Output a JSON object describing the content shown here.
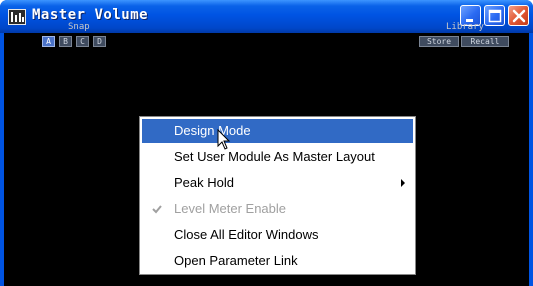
{
  "window": {
    "title": "Master Volume",
    "app_icon": "app-icon",
    "controls": [
      "minimize-icon",
      "maximize-icon",
      "close-icon"
    ]
  },
  "snap": {
    "label": "Snap",
    "buttons": [
      "A",
      "B",
      "C",
      "D"
    ],
    "active": "A"
  },
  "library": {
    "label": "Library",
    "store_label": "Store",
    "recall_label": "Recall"
  },
  "context_menu": {
    "items": [
      {
        "label": "Design Mode",
        "highlighted": true
      },
      {
        "label": "Set User Module As Master Layout"
      },
      {
        "label": "Peak Hold",
        "submenu": true
      },
      {
        "label": "Level Meter Enable",
        "checked": true,
        "disabled": true
      },
      {
        "label": "Close All Editor Windows"
      },
      {
        "label": "Open Parameter Link"
      }
    ]
  },
  "colors": {
    "titlebar": "#0054e3",
    "background": "#000000",
    "highlight": "#316ac5",
    "close_button": "#e25a36"
  }
}
